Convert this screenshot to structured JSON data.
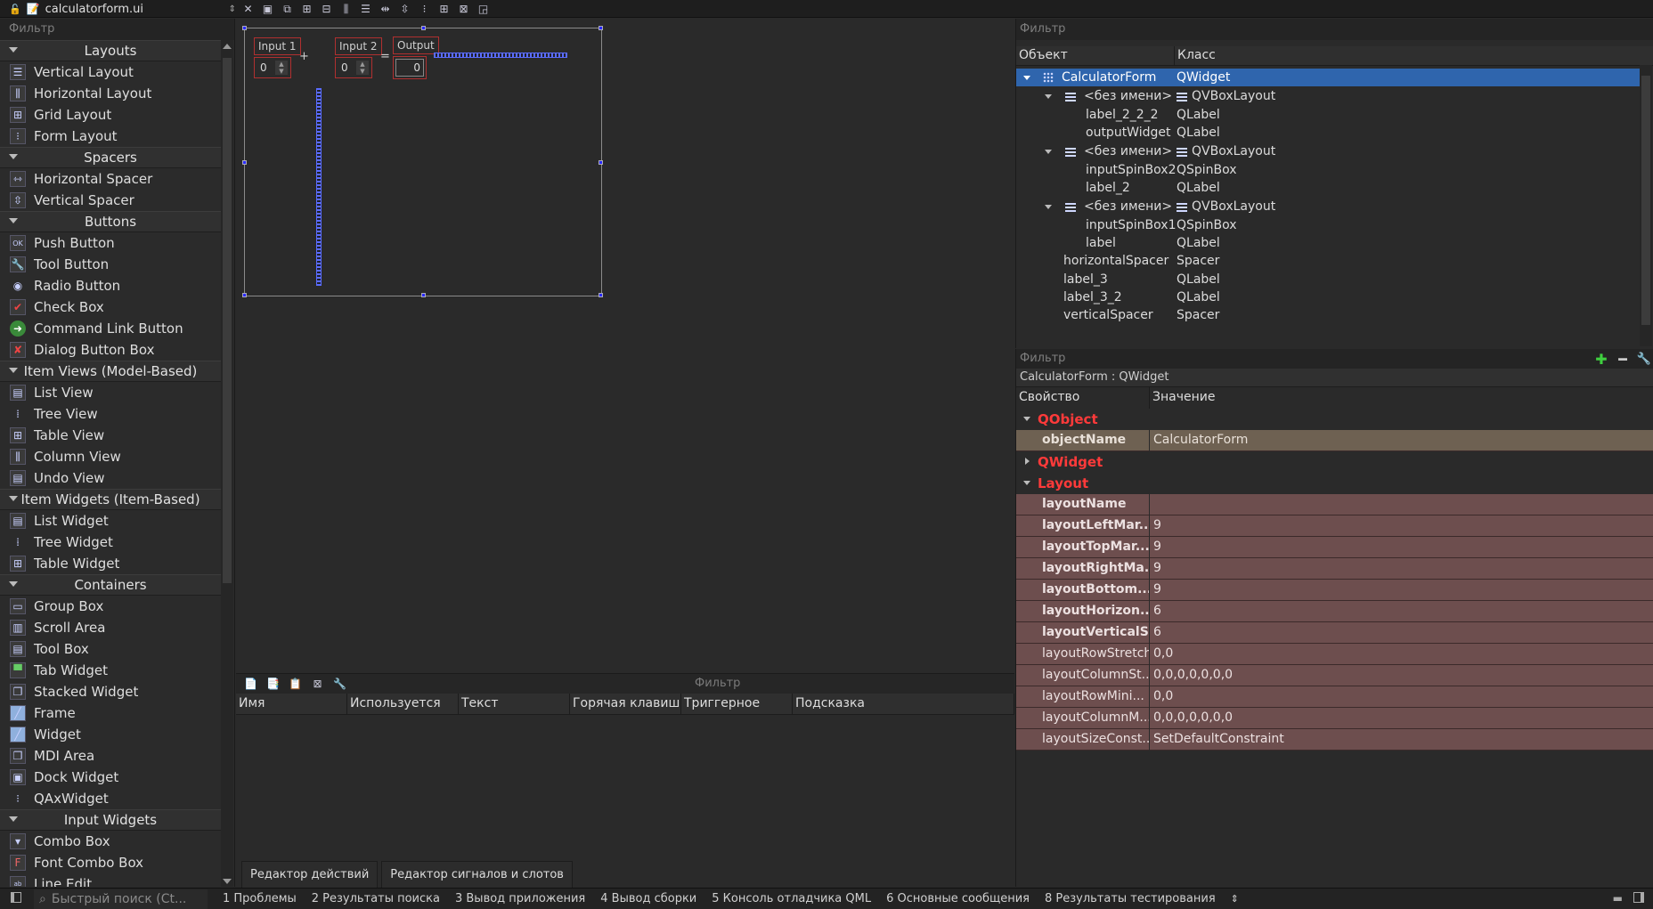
{
  "topbar": {
    "file_name": "calculatorform.ui"
  },
  "widgetbox": {
    "filter_placeholder": "Фильтр",
    "categories": [
      {
        "label": "Layouts",
        "items": [
          "Vertical Layout",
          "Horizontal Layout",
          "Grid Layout",
          "Form Layout"
        ]
      },
      {
        "label": "Spacers",
        "items": [
          "Horizontal Spacer",
          "Vertical Spacer"
        ]
      },
      {
        "label": "Buttons",
        "items": [
          "Push Button",
          "Tool Button",
          "Radio Button",
          "Check Box",
          "Command Link Button",
          "Dialog Button Box"
        ]
      },
      {
        "label": "Item Views (Model-Based)",
        "items": [
          "List View",
          "Tree View",
          "Table View",
          "Column View",
          "Undo View"
        ]
      },
      {
        "label": "Item Widgets (Item-Based)",
        "items": [
          "List Widget",
          "Tree Widget",
          "Table Widget"
        ]
      },
      {
        "label": "Containers",
        "items": [
          "Group Box",
          "Scroll Area",
          "Tool Box",
          "Tab Widget",
          "Stacked Widget",
          "Frame",
          "Widget",
          "MDI Area",
          "Dock Widget",
          "QAxWidget"
        ]
      },
      {
        "label": "Input Widgets",
        "items": [
          "Combo Box",
          "Font Combo Box",
          "Line Edit"
        ]
      }
    ]
  },
  "form": {
    "input1_label": "Input 1",
    "input1_value": "0",
    "plus": "+",
    "input2_label": "Input 2",
    "input2_value": "0",
    "equals": "=",
    "output_label": "Output",
    "output_value": "0"
  },
  "action_editor": {
    "filter_placeholder": "Фильтр",
    "columns": [
      "Имя",
      "Используется",
      "Текст",
      "Горячая клавиша",
      "Триггерное",
      "Подсказка"
    ],
    "tabs": [
      "Редактор действий",
      "Редактор сигналов и слотов"
    ]
  },
  "object_inspector": {
    "filter_placeholder": "Фильтр",
    "columns": [
      "Объект",
      "Класс"
    ],
    "rows": [
      {
        "object": "CalculatorForm",
        "class": "QWidget"
      },
      {
        "object": "<без имени>",
        "class": "QVBoxLayout"
      },
      {
        "object": "label_2_2_2",
        "class": "QLabel"
      },
      {
        "object": "outputWidget",
        "class": "QLabel"
      },
      {
        "object": "<без имени>",
        "class": "QVBoxLayout"
      },
      {
        "object": "inputSpinBox2",
        "class": "QSpinBox"
      },
      {
        "object": "label_2",
        "class": "QLabel"
      },
      {
        "object": "<без имени>",
        "class": "QVBoxLayout"
      },
      {
        "object": "inputSpinBox1",
        "class": "QSpinBox"
      },
      {
        "object": "label",
        "class": "QLabel"
      },
      {
        "object": "horizontalSpacer",
        "class": "Spacer"
      },
      {
        "object": "label_3",
        "class": "QLabel"
      },
      {
        "object": "label_3_2",
        "class": "QLabel"
      },
      {
        "object": "verticalSpacer",
        "class": "Spacer"
      }
    ]
  },
  "property_editor": {
    "filter_placeholder": "Фильтр",
    "class_line": "CalculatorForm : QWidget",
    "columns": [
      "Свойство",
      "Значение"
    ],
    "groups": {
      "qobject": "QObject",
      "qwidget": "QWidget",
      "layout": "Layout"
    },
    "object_name": {
      "name": "objectName",
      "value": "CalculatorForm"
    },
    "layout_props": [
      {
        "name": "layoutName",
        "value": ""
      },
      {
        "name": "layoutLeftMar...",
        "value": "9"
      },
      {
        "name": "layoutTopMar...",
        "value": "9"
      },
      {
        "name": "layoutRightMa...",
        "value": "9"
      },
      {
        "name": "layoutBottom...",
        "value": "9"
      },
      {
        "name": "layoutHorizon...",
        "value": "6"
      },
      {
        "name": "layoutVerticalS...",
        "value": "6"
      },
      {
        "name": "layoutRowStretch",
        "value": "0,0"
      },
      {
        "name": "layoutColumnSt...",
        "value": "0,0,0,0,0,0,0"
      },
      {
        "name": "layoutRowMini...",
        "value": "0,0"
      },
      {
        "name": "layoutColumnM...",
        "value": "0,0,0,0,0,0,0"
      },
      {
        "name": "layoutSizeConst...",
        "value": "SetDefaultConstraint"
      }
    ]
  },
  "statusbar": {
    "search_placeholder": "Быстрый поиск (Ct...",
    "items": [
      "1 Проблемы",
      "2 Результаты поиска",
      "3 Вывод приложения",
      "4 Вывод сборки",
      "5 Консоль отладчика QML",
      "6 Основные сообщения",
      "8 Результаты тестирования"
    ]
  },
  "colors": {
    "selection": "#2f65ad",
    "group_header": "#ff3a3a",
    "objectname_row": "#6e6152",
    "layout_row": "#6d4e4e",
    "spacer": "#5a6cff"
  }
}
